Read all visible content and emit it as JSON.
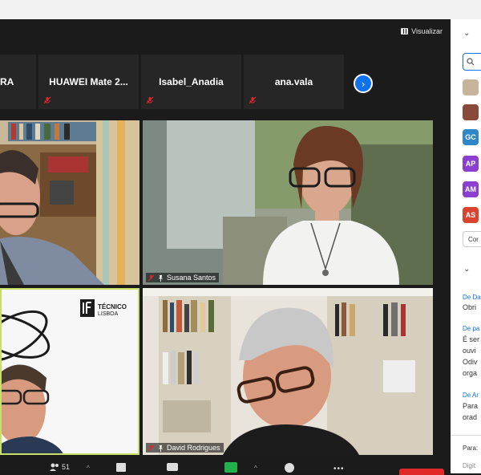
{
  "header": {
    "visualizar_label": "Visualizar"
  },
  "participants_strip": [
    {
      "name": "RA"
    },
    {
      "name": "HUAWEI Mate 2..."
    },
    {
      "name": "Isabel_Anadia"
    },
    {
      "name": "ana.vala"
    }
  ],
  "video_tiles": [
    {
      "name": ""
    },
    {
      "name": "Susana Santos"
    },
    {
      "name": "",
      "logo_text_1": "TÉCNICO",
      "logo_text_2": "LISBOA",
      "logo_mark": "IST"
    },
    {
      "name": "David Rodrigues"
    }
  ],
  "toolbar": {
    "participants_count": "51"
  },
  "side_panel": {
    "avatars": [
      "GC",
      "AP",
      "AM",
      "AS"
    ],
    "avatar_colors": [
      "#2f86c9",
      "#8a3fd1",
      "#8a3fd1",
      "#d9432f"
    ],
    "more_label": "Cor",
    "chat": [
      {
        "from": "De Da",
        "lines": [
          "Obri"
        ]
      },
      {
        "from": "De pa",
        "lines": [
          "É ser",
          "ouvi",
          "Odiv",
          "orga"
        ]
      },
      {
        "from": "De Ar",
        "lines": [
          "Para",
          "orad"
        ]
      }
    ],
    "to_label": "Para:",
    "input_placeholder": "Digit"
  },
  "colors": {
    "accent": "#0e72ed",
    "mic_muted": "#e02828"
  }
}
